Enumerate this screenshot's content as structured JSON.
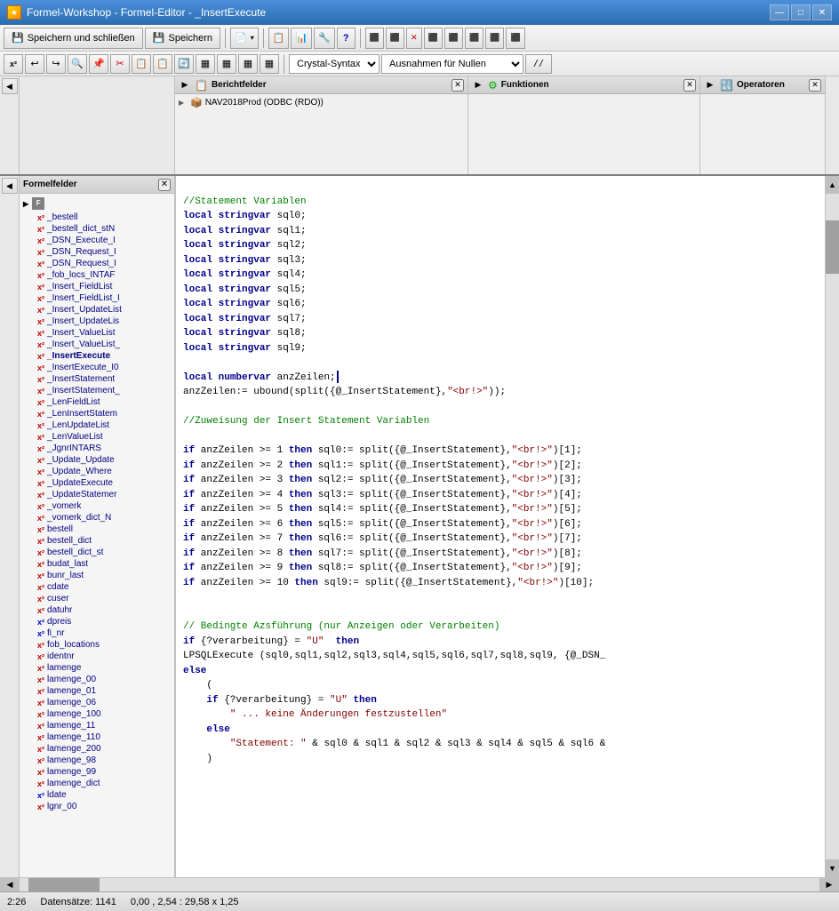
{
  "titleBar": {
    "icon": "★",
    "title": "Formel-Workshop - Formel-Editor - _InsertExecute",
    "minimizeBtn": "—",
    "maximizeBtn": "□",
    "closeBtn": "✕"
  },
  "toolbar1": {
    "saveCloseBtn": "Speichern und schließen",
    "saveBtn": "Speichern",
    "dropdownArrow": "▾",
    "icons": [
      "📄",
      "📋",
      "🔧",
      "✂️",
      "📌",
      "❓"
    ]
  },
  "toolbar2": {
    "x2Btn": "x²",
    "undoBtn": "↩",
    "redoBtn": "↪",
    "icons": [
      "🔍",
      "🔖",
      "✂️",
      "📋",
      "📋",
      "🔄",
      "📊",
      "📊",
      "📊",
      "📊"
    ],
    "syntaxDropdown": "Crystal-Syntax",
    "nullDropdown": "Ausnahmen für Nullen",
    "commentBtn": "//"
  },
  "sidebarTitle": "Formelfelder",
  "sidebarItems": [
    "_bestell",
    "_bestell_dict_stN",
    "_DSN_Execute_I",
    "_DSN_Request_I",
    "_DSN_Request_I",
    "_fob_locs_INTAF",
    "_Insert_FieldList",
    "_Insert_FieldList_",
    "_Insert_UpdateList",
    "_Insert_UpdateList_",
    "_Insert_ValueList",
    "_Insert_ValueList_",
    "_InsertExecute",
    "_InsertExecute_I0",
    "_InsertStatement",
    "_InsertStatement_",
    "_LenFieldList",
    "_LenInsertStatem",
    "_LenUpdateList",
    "_LenValueList",
    "_JgnrINTARS",
    "_Update_Update",
    "_Update_Where",
    "_UpdateExecute",
    "_UpdateStatemer",
    "_vomerk",
    "_vomerk_dict_N",
    "bestell",
    "bestell_dict",
    "bestell_dict_st",
    "budat_last",
    "bunr_last",
    "cdate",
    "cuser",
    "datuhr",
    "dpreis",
    "fi_nr",
    "fob_locations",
    "identnr",
    "lamenge",
    "lamenge_00",
    "lamenge_01",
    "lamenge_06",
    "lamenge_100",
    "lamenge_11",
    "lamenge_110",
    "lamenge_200",
    "lamenge_98",
    "lamenge_99",
    "lamenge_dict",
    "ldate",
    "lgnr_00"
  ],
  "panels": {
    "berichtfelder": {
      "title": "Berichtfelder",
      "subitem": "NAV2018Prod (ODBC (RDO))"
    },
    "funktionen": {
      "title": "Funktionen"
    },
    "operatoren": {
      "title": "Operatoren"
    }
  },
  "code": {
    "lines": [
      "",
      "//Statement Variablen",
      "local stringvar sql0;",
      "local stringvar sql1;",
      "local stringvar sql2;",
      "local stringvar sql3;",
      "local stringvar sql4;",
      "local stringvar sql5;",
      "local stringvar sql6;",
      "local stringvar sql7;",
      "local stringvar sql8;",
      "local stringvar sql9;",
      "",
      "local numbervar anzZeilen;",
      "anzZeilen:= ubound(split({@_InsertStatement},\"<br!>\"));",
      "",
      "//Zuweisung der Insert Statement Variablen",
      "",
      "if anzZeilen >= 1 then sql0:= split({@_InsertStatement},\"<br!>\")[1];",
      "if anzZeilen >= 2 then sql1:= split({@_InsertStatement},\"<br!>\")[2];",
      "if anzZeilen >= 3 then sql2:= split({@_InsertStatement},\"<br!>\")[3];",
      "if anzZeilen >= 4 then sql3:= split({@_InsertStatement},\"<br!>\")[4];",
      "if anzZeilen >= 5 then sql4:= split({@_InsertStatement},\"<br!>\")[5];",
      "if anzZeilen >= 6 then sql5:= split({@_InsertStatement},\"<br!>\")[6];",
      "if anzZeilen >= 7 then sql6:= split({@_InsertStatement},\"<br!>\")[7];",
      "if anzZeilen >= 8 then sql7:= split({@_InsertStatement},\"<br!>\")[8];",
      "if anzZeilen >= 9 then sql8:= split({@_InsertStatement},\"<br!>\")[9];",
      "if anzZeilen >= 10 then sql9:= split({@_InsertStatement},\"<br!>\")[10];",
      "",
      "",
      "// Bedingte Azsführung (nur Anzeigen oder Verarbeiten)",
      "if {?verarbeitung} = \"U\"  then",
      "LPSQLExecute (sql0,sql1,sql2,sql3,sql4,sql5,sql6,sql7,sql8,sql9, {@_DSN_",
      "else",
      "    (",
      "    if {?verarbeitung} = \"U\" then",
      "        \" ... keine Änderungen festzustellen\"",
      "    else",
      "        \"Statement: \" & sql0 & sql1 & sql2 & sql3 & sql4 & sql5 & sql6 &",
      "    )"
    ]
  },
  "statusBar": {
    "position": "2:26",
    "records": "Datensätze: 1141",
    "coords": "0,00 , 2,54 : 29,58 x 1,25"
  }
}
